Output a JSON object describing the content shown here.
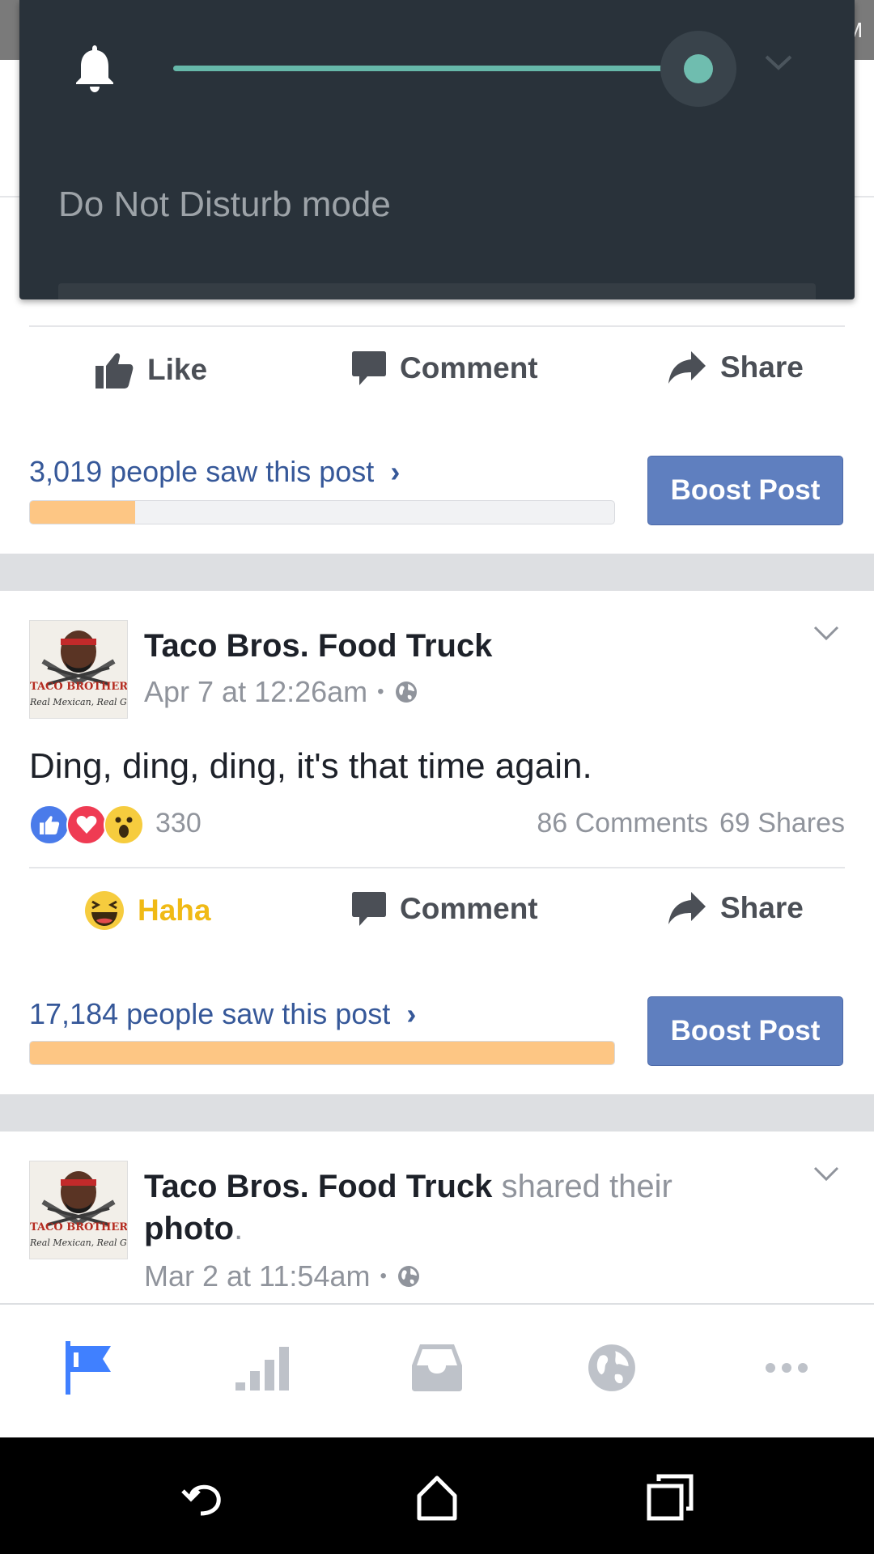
{
  "status_bar": {
    "right_text": "M"
  },
  "dnd_panel": {
    "label": "Do Not Disturb mode",
    "volume_level": 1.0,
    "accent_color": "#6fbdaf"
  },
  "prev_post": {
    "actions": {
      "like": "Like",
      "comment": "Comment",
      "share": "Share"
    },
    "reach_text": "3,019 people saw this post",
    "reach_fill": 0.18,
    "boost_label": "Boost Post"
  },
  "post": {
    "page_name": "Taco Bros. Food Truck",
    "timestamp": "Apr 7 at 12:26am",
    "dot": "•",
    "message": "Ding, ding, ding, it's that time again.",
    "reaction_count": "330",
    "comments": "86 Comments",
    "shares": "69 Shares",
    "actions": {
      "reaction": "Haha",
      "comment": "Comment",
      "share": "Share"
    },
    "reach_text": "17,184 people saw this post",
    "reach_fill": 1.0,
    "boost_label": "Boost Post",
    "avatar_text": {
      "line1": "TACO BROTHERS",
      "line2": "Real Mexican, Real Good"
    }
  },
  "next_post": {
    "page_name": "Taco Bros. Food Truck",
    "shared_text": "shared their",
    "photo_text": "photo",
    "period": ".",
    "timestamp": "Mar 2 at 11:54am",
    "dot": "•"
  },
  "tabs": [
    {
      "icon": "flag-icon",
      "active": true
    },
    {
      "icon": "bar-chart-icon",
      "active": false
    },
    {
      "icon": "inbox-icon",
      "active": false
    },
    {
      "icon": "globe-icon",
      "active": false
    },
    {
      "icon": "more-icon",
      "active": false
    }
  ],
  "colors": {
    "link": "#365899",
    "boost": "#5f7fbf",
    "reach_fill": "#fdc684",
    "haha": "#f0ba15",
    "active_tab": "#4080ff"
  }
}
